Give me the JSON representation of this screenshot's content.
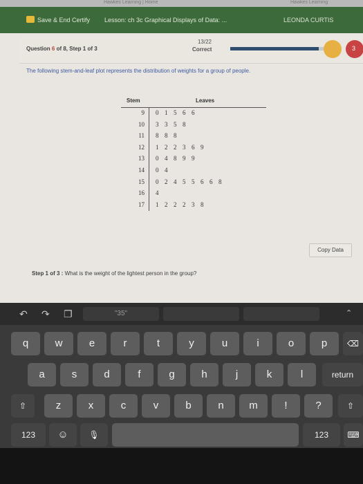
{
  "browser": {
    "tab_left": "Hawkes Learning | Home",
    "tab_right": "Hawkes Learning"
  },
  "nav": {
    "save_end": "Save & End Certify",
    "lesson": "Lesson: ch 3c Graphical Displays of Data: ...",
    "user": "LEONDA CURTIS"
  },
  "question": {
    "label_prefix": "Question ",
    "number": "6",
    "label_suffix": " of 8, Step 1 of 3",
    "score": "13/22",
    "status": "Correct",
    "progress_fraction": 0.85,
    "badge_count": "3"
  },
  "prompt": "The following stem-and-leaf plot represents the distribution of weights for a group of people.",
  "table": {
    "header_stem": "Stem",
    "header_leaves": "Leaves",
    "rows": [
      {
        "stem": "9",
        "leaves": [
          "0",
          "1",
          "5",
          "6",
          "6"
        ]
      },
      {
        "stem": "10",
        "leaves": [
          "3",
          "3",
          "5",
          "8"
        ]
      },
      {
        "stem": "11",
        "leaves": [
          "8",
          "8",
          "8"
        ]
      },
      {
        "stem": "12",
        "leaves": [
          "1",
          "2",
          "2",
          "3",
          "6",
          "9"
        ]
      },
      {
        "stem": "13",
        "leaves": [
          "0",
          "4",
          "8",
          "9",
          "9"
        ]
      },
      {
        "stem": "14",
        "leaves": [
          "0",
          "4"
        ]
      },
      {
        "stem": "15",
        "leaves": [
          "0",
          "2",
          "4",
          "5",
          "5",
          "6",
          "6",
          "8"
        ]
      },
      {
        "stem": "16",
        "leaves": [
          "4"
        ]
      },
      {
        "stem": "17",
        "leaves": [
          "1",
          "2",
          "2",
          "2",
          "3",
          "8"
        ]
      }
    ]
  },
  "copy_button": "Copy Data",
  "step": {
    "label": "Step 1 of 3 :",
    "question": "What is the weight of the lightest person in the group?"
  },
  "keyboard": {
    "suggestion": "\"35\"",
    "row1": [
      "q",
      "w",
      "e",
      "r",
      "t",
      "y",
      "u",
      "i",
      "o",
      "p"
    ],
    "row2": [
      "a",
      "s",
      "d",
      "f",
      "g",
      "h",
      "j",
      "k",
      "l"
    ],
    "row3": [
      "z",
      "x",
      "c",
      "v",
      "b",
      "n",
      "m",
      "!",
      ";",
      "?",
      "."
    ],
    "return_label": "return",
    "numbers_label": "123"
  },
  "colors": {
    "nav_green": "#3d6a3a",
    "prompt_blue": "#3c5aa0",
    "progress": "#2f4d6e"
  }
}
